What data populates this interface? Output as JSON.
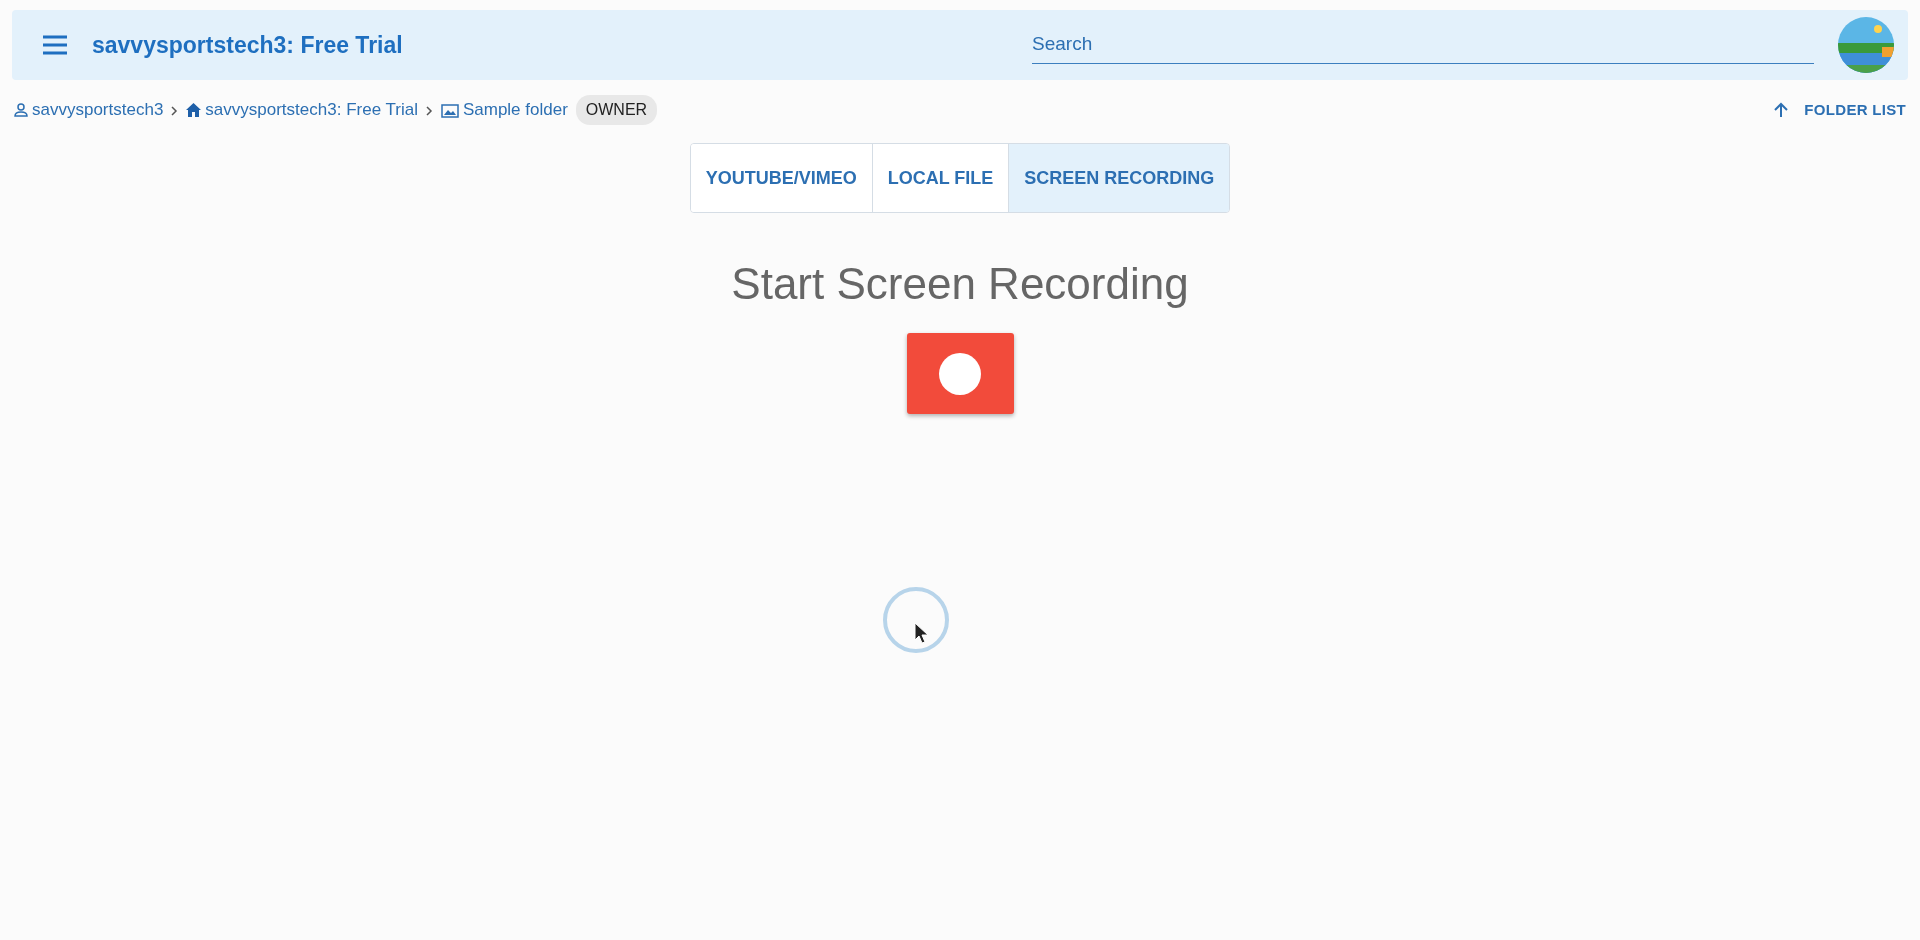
{
  "header": {
    "title": "savvysportstech3: Free Trial",
    "search": {
      "placeholder": "Search"
    }
  },
  "breadcrumbs": [
    {
      "kind": "user",
      "label": "savvysportstech3"
    },
    {
      "kind": "home",
      "label": "savvysportstech3: Free Trial"
    },
    {
      "kind": "folder",
      "label": "Sample folder"
    }
  ],
  "role_badge": "OWNER",
  "folder_list_link": "FOLDER LIST",
  "tabs": [
    {
      "label": "YOUTUBE/VIMEO",
      "selected": false
    },
    {
      "label": "LOCAL FILE",
      "selected": false
    },
    {
      "label": "SCREEN RECORDING",
      "selected": true
    }
  ],
  "heading": "Start Screen Recording"
}
